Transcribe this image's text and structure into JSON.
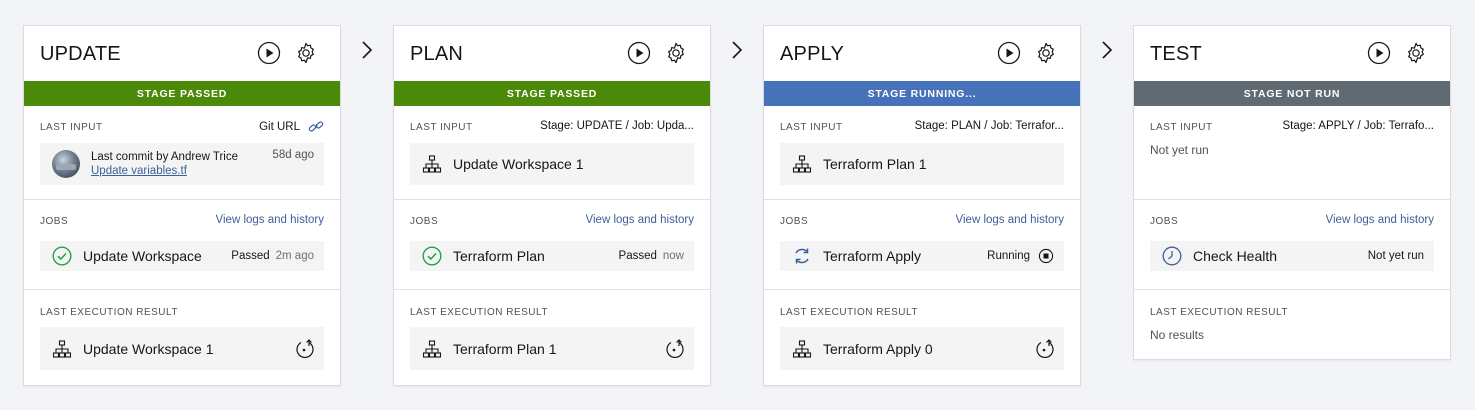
{
  "colors": {
    "passed": "#4b8a08",
    "running": "#4572b8",
    "not_run": "#5f6a73",
    "link": "#3d5f9a"
  },
  "stages": [
    {
      "title": "UPDATE",
      "status": "STAGE PASSED",
      "last_input_label": "LAST INPUT",
      "last_input_right": "Git URL",
      "commit_text": "Last commit by Andrew Trice",
      "commit_link": "Update variables.tf",
      "commit_age": "58d ago",
      "jobs_label": "JOBS",
      "jobs_link": "View logs and history",
      "job_name": "Update Workspace",
      "job_status": "Passed",
      "job_time": "2m ago",
      "result_label": "LAST EXECUTION RESULT",
      "result_name": "Update Workspace 1"
    },
    {
      "title": "PLAN",
      "status": "STAGE PASSED",
      "last_input_label": "LAST INPUT",
      "last_input_right": "Stage: UPDATE  /  Job: Upda...",
      "input_item": "Update Workspace 1",
      "jobs_label": "JOBS",
      "jobs_link": "View logs and history",
      "job_name": "Terraform Plan",
      "job_status": "Passed",
      "job_time": "now",
      "result_label": "LAST EXECUTION RESULT",
      "result_name": "Terraform Plan 1"
    },
    {
      "title": "APPLY",
      "status": "STAGE RUNNING...",
      "last_input_label": "LAST INPUT",
      "last_input_right": "Stage: PLAN  /  Job: Terrafor...",
      "input_item": "Terraform Plan 1",
      "jobs_label": "JOBS",
      "jobs_link": "View logs and history",
      "job_name": "Terraform Apply",
      "job_status": "Running",
      "result_label": "LAST EXECUTION RESULT",
      "result_name": "Terraform Apply 0"
    },
    {
      "title": "TEST",
      "status": "STAGE NOT RUN",
      "last_input_label": "LAST INPUT",
      "last_input_right": "Stage: APPLY  /  Job: Terrafo...",
      "input_empty": "Not yet run",
      "jobs_label": "JOBS",
      "jobs_link": "View logs and history",
      "job_name": "Check Health",
      "job_status": "Not yet run",
      "result_label": "LAST EXECUTION RESULT",
      "result_empty": "No results"
    }
  ]
}
